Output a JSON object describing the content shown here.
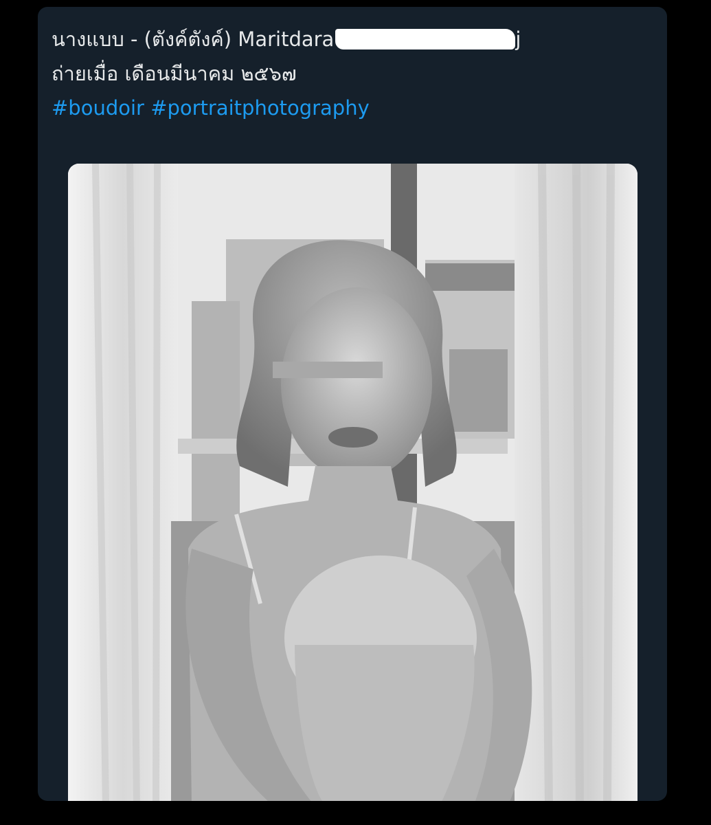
{
  "post": {
    "line1_prefix": "นางแบบ - (ตังค์ตังค์) Maritdara",
    "line1_suffix": "j",
    "line2": "ถ่ายเมื่อ เดือนมีนาคม ๒๕๖๗",
    "hashtags": [
      "#boudoir",
      "#portraitphotography"
    ]
  },
  "media": {
    "style": "black-and-white",
    "eyes_censored": true
  }
}
